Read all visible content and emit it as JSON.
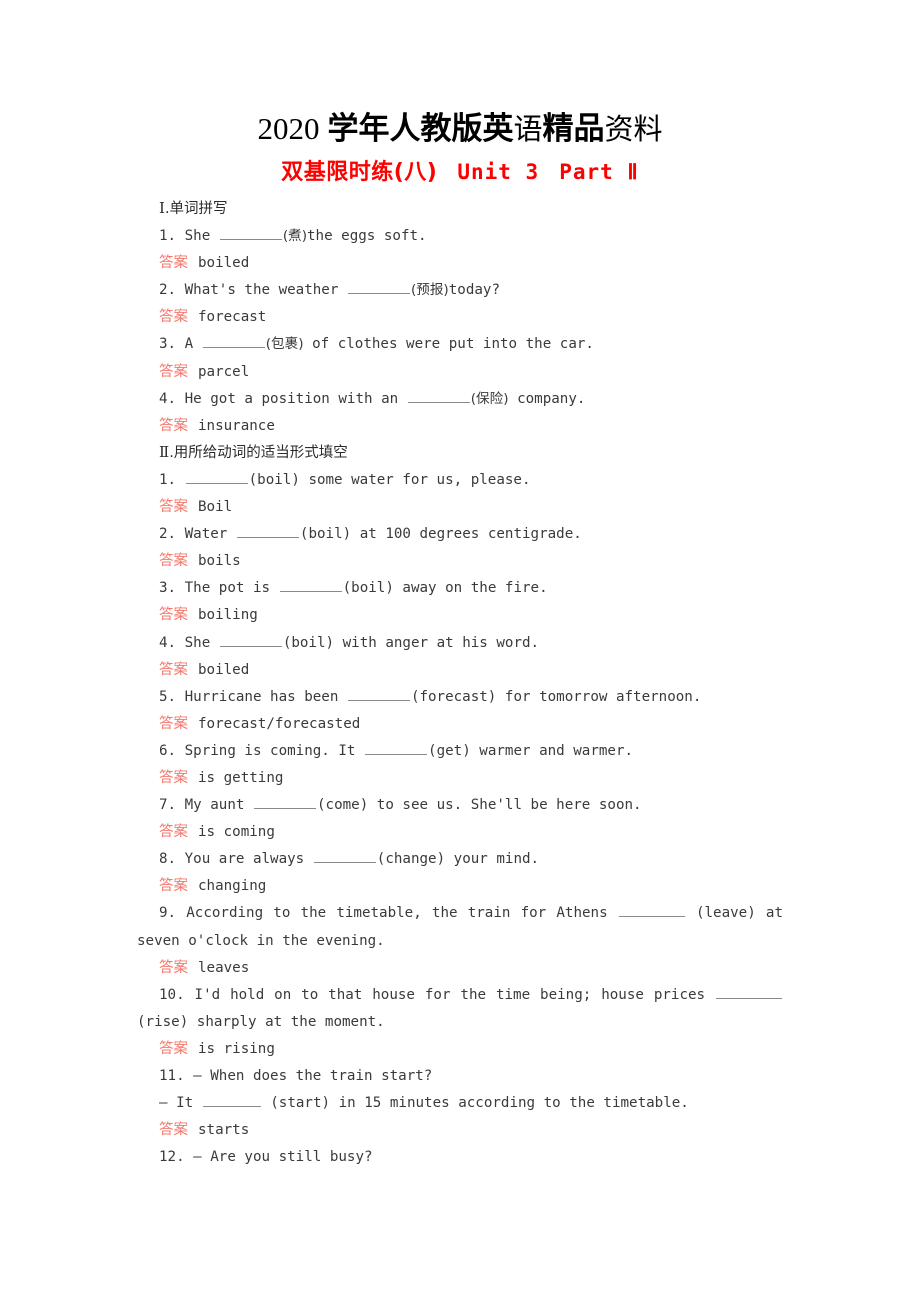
{
  "banner": {
    "year": "2020",
    "cn_bold_1": "学年人教版英",
    "cn_light_1": "语",
    "cn_bold_2": "精品",
    "cn_light_2": "资料"
  },
  "exercise_title": {
    "cn": "双基限时练(八)",
    "unit": "Unit 3",
    "part": "Part Ⅱ",
    "color": "#ff0000"
  },
  "answer_label": "答案",
  "answer_label_color": "#f4796e",
  "sections": [
    {
      "heading_numeral": "Ⅰ",
      "heading_text": ".单词拼写",
      "items": [
        {
          "number": "1.",
          "pre": "She",
          "hint": "(煮)",
          "post": "the eggs soft.",
          "answer": "boiled"
        },
        {
          "number": "2.",
          "pre": "What's the weather",
          "hint": "(预报)",
          "post": "today?",
          "answer": "forecast"
        },
        {
          "number": "3.",
          "pre": "A",
          "hint": "(包裹)",
          "post": "of clothes were put into the car.",
          "answer": "parcel"
        },
        {
          "number": "4.",
          "pre": "He got a position with an",
          "hint": "(保险)",
          "post": "company.",
          "answer": "insurance"
        }
      ]
    },
    {
      "heading_numeral": "Ⅱ",
      "heading_text": ".用所给动词的适当形式填空",
      "items": [
        {
          "number": "1.",
          "pre": "",
          "hint": "(boil)",
          "post": "some water for us, please.",
          "answer": "Boil"
        },
        {
          "number": "2.",
          "pre": "Water",
          "hint": "(boil)",
          "post": "at 100 degrees centigrade.",
          "answer": "boils"
        },
        {
          "number": "3.",
          "pre": "The pot is",
          "hint": "(boil)",
          "post": "away on the fire.",
          "answer": "boiling"
        },
        {
          "number": "4.",
          "pre": "She",
          "hint": "(boil)",
          "post": "with anger at his word.",
          "answer": "boiled"
        },
        {
          "number": "5.",
          "pre": "Hurricane has been",
          "hint": "(forecast)",
          "post": "for tomorrow afternoon.",
          "answer": "forecast/forecasted"
        },
        {
          "number": "6.",
          "pre": "Spring is coming. It",
          "hint": "(get)",
          "post": "warmer and warmer.",
          "answer": "is getting"
        },
        {
          "number": "7.",
          "pre": "My aunt",
          "hint": "(come)",
          "post": "to see us. She'll be here soon.",
          "answer": "is coming"
        },
        {
          "number": "8.",
          "pre": "You are always",
          "hint": "(change)",
          "post": "your mind.",
          "answer": "changing"
        },
        {
          "number": "9.",
          "pre": "According to the timetable, the train for Athens",
          "hint": "(leave)",
          "post": "at seven o'clock in the evening.",
          "answer": "leaves"
        },
        {
          "number": "10.",
          "pre": "I'd hold on to that house for the time being; house prices",
          "hint": "(rise)",
          "post": "sharply at the moment.",
          "answer": "is rising"
        },
        {
          "number": "11.",
          "dialogue_q": "— When does the train start?",
          "pre": "— It",
          "hint": "(start)",
          "post": "in 15 minutes according to the timetable.",
          "answer": "starts"
        },
        {
          "number": "12.",
          "dialogue_q": "— Are you still busy?"
        }
      ]
    }
  ]
}
